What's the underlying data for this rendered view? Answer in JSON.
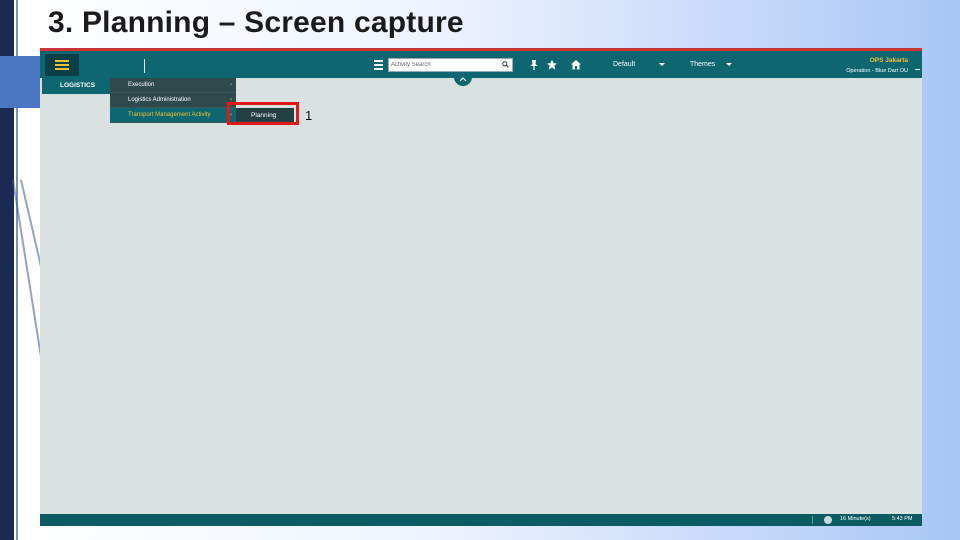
{
  "slide": {
    "title": "3. Planning – Screen capture",
    "annotation_number": "1"
  },
  "toolbar": {
    "search_placeholder": "Activity Search",
    "layout_dropdown": "Default",
    "themes_dropdown": "Themes",
    "user_name": "OPS Jakarta",
    "user_role": "Operation - Blue Dart OU"
  },
  "menu": {
    "level1": "LOGISTICS",
    "level2": [
      {
        "label": "Execution"
      },
      {
        "label": "Logistics Administration"
      },
      {
        "label": "Transport Management Activity"
      }
    ],
    "level3": "Planning"
  },
  "statusbar": {
    "timer": "16 Minute(s)",
    "clock": "5:43 PM"
  },
  "colors": {
    "topbar": "#0d6670",
    "accent_yellow": "#f2c230",
    "highlight_red": "#e01818",
    "workspace": "#d9e1e1"
  },
  "icons": {
    "menu": "hamburger-icon",
    "list": "list-icon",
    "search": "search-icon",
    "pin": "pin-icon",
    "favorite": "star-icon",
    "home": "home-icon",
    "collapse": "chevron-up-icon",
    "timer": "timer-icon"
  }
}
